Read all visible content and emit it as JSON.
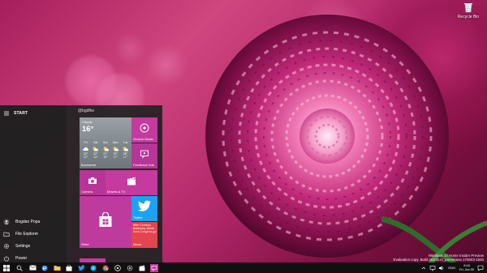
{
  "desktop": {
    "recycle_bin_label": "Recycle Bin"
  },
  "watermark": {
    "line1": "Windows 10 Home Insider Preview",
    "line2": "Evaluation copy. Build 16215.rs_prerelease.170603-1840"
  },
  "start_menu": {
    "title": "START",
    "left_items": [
      {
        "label": "Bogdan Popa",
        "icon": "user-avatar-icon"
      },
      {
        "label": "File Explorer",
        "icon": "folder-icon"
      },
      {
        "label": "Settings",
        "icon": "gear-icon"
      },
      {
        "label": "Power",
        "icon": "power-icon"
      }
    ],
    "group_title": "@bgdftw",
    "tiles": {
      "weather": {
        "condition": "Cloudy",
        "temp": "16°",
        "location": "Bucharest",
        "days": [
          {
            "day": "Fri",
            "hi": "20°",
            "lo": "12°",
            "icon": "cloud-icon"
          },
          {
            "day": "Sat",
            "hi": "22°",
            "lo": "13°",
            "icon": "partly-sunny-icon"
          },
          {
            "day": "Sun",
            "hi": "27°",
            "lo": "15°",
            "icon": "partly-sunny-icon"
          },
          {
            "day": "Mon",
            "hi": "29°",
            "lo": "17°",
            "icon": "partly-sunny-icon"
          },
          {
            "day": "Tue",
            "hi": "28°",
            "lo": "17°",
            "icon": "partly-sunny-icon"
          }
        ]
      },
      "groove": {
        "label": "Groove Music"
      },
      "feedback": {
        "label": "Feedback Hub"
      },
      "camera": {
        "label": "Camera"
      },
      "movies": {
        "label": "Movies & TV"
      },
      "store": {
        "label": "Store"
      },
      "twitter": {
        "label": "Twitter"
      },
      "news": {
        "headline": "After Comey's testimony, where does Congress go",
        "label": "News"
      }
    }
  },
  "taskbar": {
    "icons": [
      "windows-start-icon",
      "search-icon",
      "task-view-icon",
      "mail-icon",
      "edge-icon",
      "file-explorer-icon",
      "store-icon",
      "photos-icon",
      "twitter-icon",
      "skype-icon",
      "chrome-icon",
      "groove-icon",
      "settings-icon",
      "movies-icon",
      "feedback-icon"
    ],
    "language": "ENG",
    "time": "8:18",
    "date": "Fri, Jun 09"
  },
  "colors": {
    "accent": "#c43a9e",
    "twitter": "#1da1f2",
    "news": "#e2454e",
    "taskbar": "#101010",
    "start_bg": "#242424"
  }
}
